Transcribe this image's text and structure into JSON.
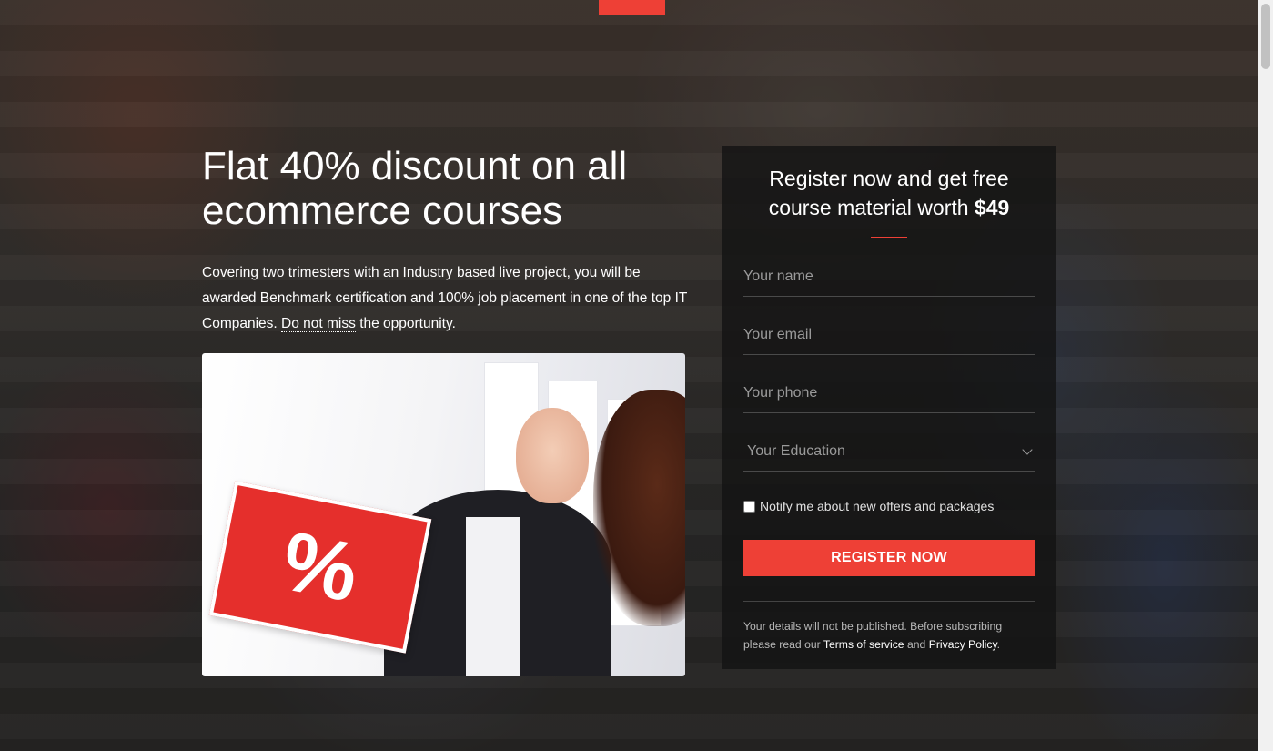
{
  "hero": {
    "title": "Flat 40% discount on all ecommerce courses",
    "text_before": "Covering two trimesters with an Industry based live project, you will be awarded Benchmark certification and 100% job placement in one of the top IT Companies.",
    "text_emphasis": "Do not miss",
    "text_after": "the opportunity.",
    "image_badge": "%"
  },
  "form": {
    "title_prefix": "Register now and get free course material worth",
    "title_price": "$49",
    "name_placeholder": "Your name",
    "email_placeholder": "Your email",
    "phone_placeholder": "Your phone",
    "education_selected": "Your Education",
    "notify_label": "Notify me about new offers and packages",
    "submit_label": "REGISTER NOW",
    "disclaimer_prefix": "Your details will not be published. Before subscribing please read our",
    "terms_link": "Terms of service",
    "and_text": "and",
    "privacy_link": "Privacy Policy",
    "disclaimer_end": "."
  },
  "colors": {
    "accent": "#ee4036",
    "panel_bg": "#141414"
  }
}
